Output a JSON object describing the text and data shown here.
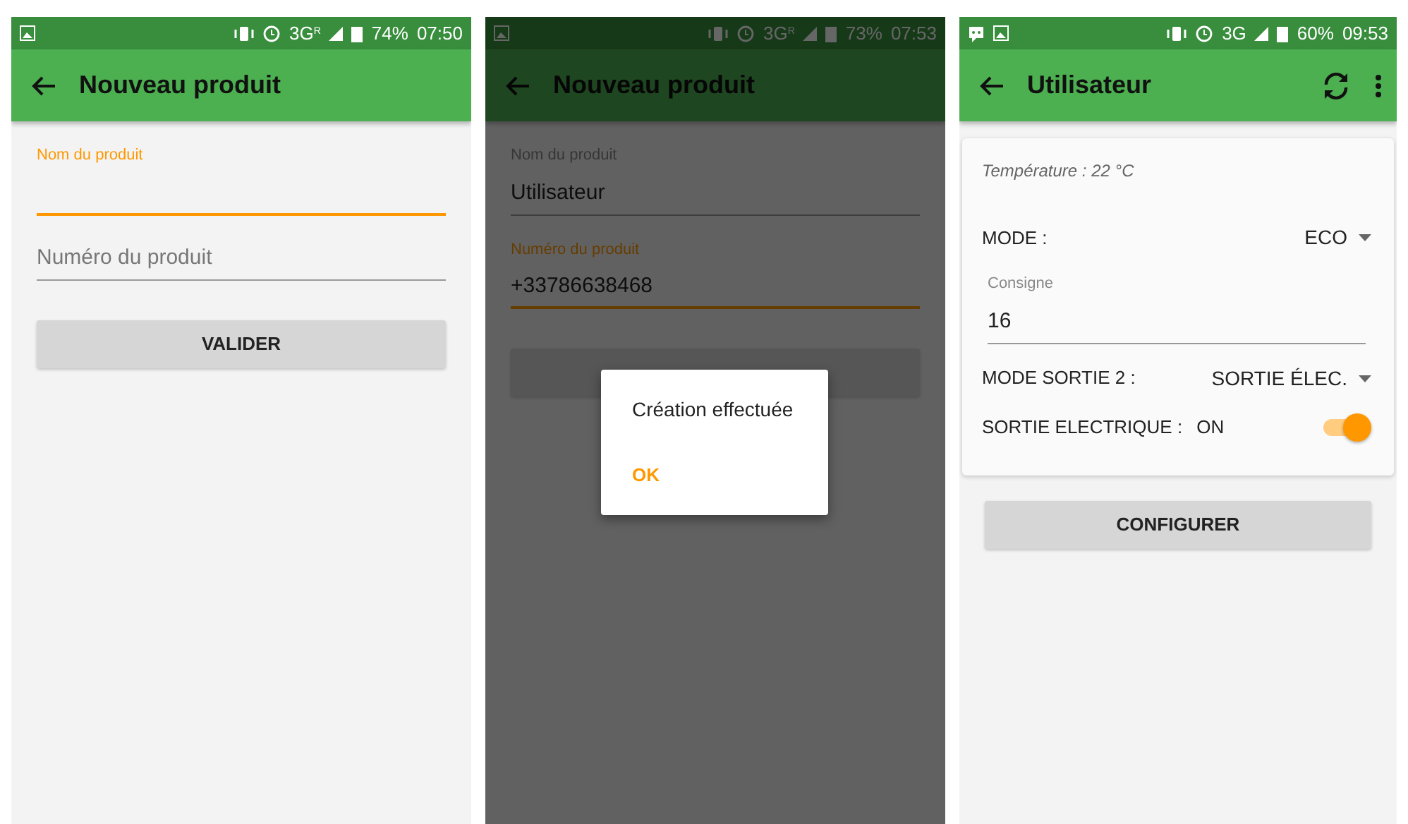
{
  "screens": [
    {
      "status_bar": {
        "chat_notification": false,
        "network": "3G$^{R}$",
        "battery": "74%",
        "time": "07:50"
      },
      "app_bar": {
        "title": "Nouveau produit",
        "refresh_button": false,
        "overflow_menu": false
      },
      "dimmed": false,
      "items": [
        {
          "kind": "field",
          "label": "Nom du produit",
          "focused": true
        },
        {
          "kind": "field",
          "placeholder": "Numéro du produit",
          "focused": false
        },
        {
          "kind": "button",
          "label": "VALIDER"
        }
      ]
    },
    {
      "status_bar": {
        "chat_notification": false,
        "network": "3G$^{R}$",
        "battery": "73%",
        "time": "07:53"
      },
      "app_bar": {
        "title": "Nouveau produit",
        "refresh_button": false,
        "overflow_menu": false
      },
      "dimmed": true,
      "items": [
        {
          "kind": "field",
          "label": "Nom du produit",
          "value": "Utilisateur",
          "focused": false
        },
        {
          "kind": "field",
          "label": "Numéro du produit",
          "value": "+33786638468",
          "focused": true
        },
        {
          "kind": "button"
        }
      ],
      "dialog": {
        "message": "Création effectuée",
        "button": "OK"
      }
    },
    {
      "status_bar": {
        "chat_notification": true,
        "network": "3G",
        "battery": "60%",
        "time": "09:53"
      },
      "app_bar": {
        "title": "Utilisateur",
        "refresh_button": true,
        "overflow_menu": true
      },
      "dimmed": false,
      "items": [
        {
          "kind": "card",
          "rows": [
            {
              "kind": "note",
              "text": "Température : 22 °C"
            },
            {
              "kind": "select",
              "label": "MODE :",
              "value": "ECO"
            },
            {
              "kind": "field",
              "label": "Consigne",
              "value": "16",
              "focused": false
            },
            {
              "kind": "select",
              "label": "MODE SORTIE 2 :",
              "value": "SORTIE ÉLEC."
            },
            {
              "kind": "switch",
              "label": "SORTIE ELECTRIQUE :",
              "value": "ON",
              "on": true
            }
          ]
        },
        {
          "kind": "button",
          "label": "CONFIGURER"
        }
      ]
    }
  ]
}
